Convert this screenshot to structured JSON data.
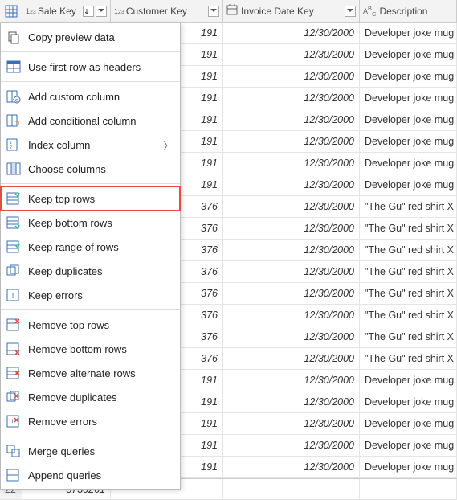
{
  "columns": {
    "saleKey": {
      "label": "Sale Key",
      "type": "123"
    },
    "customerKey": {
      "label": "Customer Key",
      "type": "123"
    },
    "invoiceDateKey": {
      "label": "Invoice Date Key",
      "type": "date"
    },
    "description": {
      "label": "Description",
      "type": "abc"
    }
  },
  "menu": {
    "copyPreview": "Copy preview data",
    "useFirstRow": "Use first row as headers",
    "addCustom": "Add custom column",
    "addConditional": "Add conditional column",
    "indexColumn": "Index column",
    "chooseColumns": "Choose columns",
    "keepTop": "Keep top rows",
    "keepBottom": "Keep bottom rows",
    "keepRange": "Keep range of rows",
    "keepDup": "Keep duplicates",
    "keepErrors": "Keep errors",
    "removeTop": "Remove top rows",
    "removeBottom": "Remove bottom rows",
    "removeAlt": "Remove alternate rows",
    "removeDup": "Remove duplicates",
    "removeErrors": "Remove errors",
    "mergeQueries": "Merge queries",
    "appendQueries": "Append queries"
  },
  "rows": [
    {
      "cust": "191",
      "date": "12/30/2000",
      "desc": "Developer joke mug"
    },
    {
      "cust": "191",
      "date": "12/30/2000",
      "desc": "Developer joke mug"
    },
    {
      "cust": "191",
      "date": "12/30/2000",
      "desc": "Developer joke mug"
    },
    {
      "cust": "191",
      "date": "12/30/2000",
      "desc": "Developer joke mug"
    },
    {
      "cust": "191",
      "date": "12/30/2000",
      "desc": "Developer joke mug"
    },
    {
      "cust": "191",
      "date": "12/30/2000",
      "desc": "Developer joke mug"
    },
    {
      "cust": "191",
      "date": "12/30/2000",
      "desc": "Developer joke mug"
    },
    {
      "cust": "191",
      "date": "12/30/2000",
      "desc": "Developer joke mug"
    },
    {
      "cust": "376",
      "date": "12/30/2000",
      "desc": "\"The Gu\" red shirt X"
    },
    {
      "cust": "376",
      "date": "12/30/2000",
      "desc": "\"The Gu\" red shirt X"
    },
    {
      "cust": "376",
      "date": "12/30/2000",
      "desc": "\"The Gu\" red shirt X"
    },
    {
      "cust": "376",
      "date": "12/30/2000",
      "desc": "\"The Gu\" red shirt X"
    },
    {
      "cust": "376",
      "date": "12/30/2000",
      "desc": "\"The Gu\" red shirt X"
    },
    {
      "cust": "376",
      "date": "12/30/2000",
      "desc": "\"The Gu\" red shirt X"
    },
    {
      "cust": "376",
      "date": "12/30/2000",
      "desc": "\"The Gu\" red shirt X"
    },
    {
      "cust": "376",
      "date": "12/30/2000",
      "desc": "\"The Gu\" red shirt X"
    },
    {
      "cust": "191",
      "date": "12/30/2000",
      "desc": "Developer joke mug"
    },
    {
      "cust": "191",
      "date": "12/30/2000",
      "desc": "Developer joke mug"
    },
    {
      "cust": "191",
      "date": "12/30/2000",
      "desc": "Developer joke mug"
    },
    {
      "cust": "191",
      "date": "12/30/2000",
      "desc": "Developer joke mug"
    },
    {
      "cust": "191",
      "date": "12/30/2000",
      "desc": "Developer joke mug"
    }
  ],
  "lastRow": {
    "num": "22",
    "sale": "3730261"
  }
}
